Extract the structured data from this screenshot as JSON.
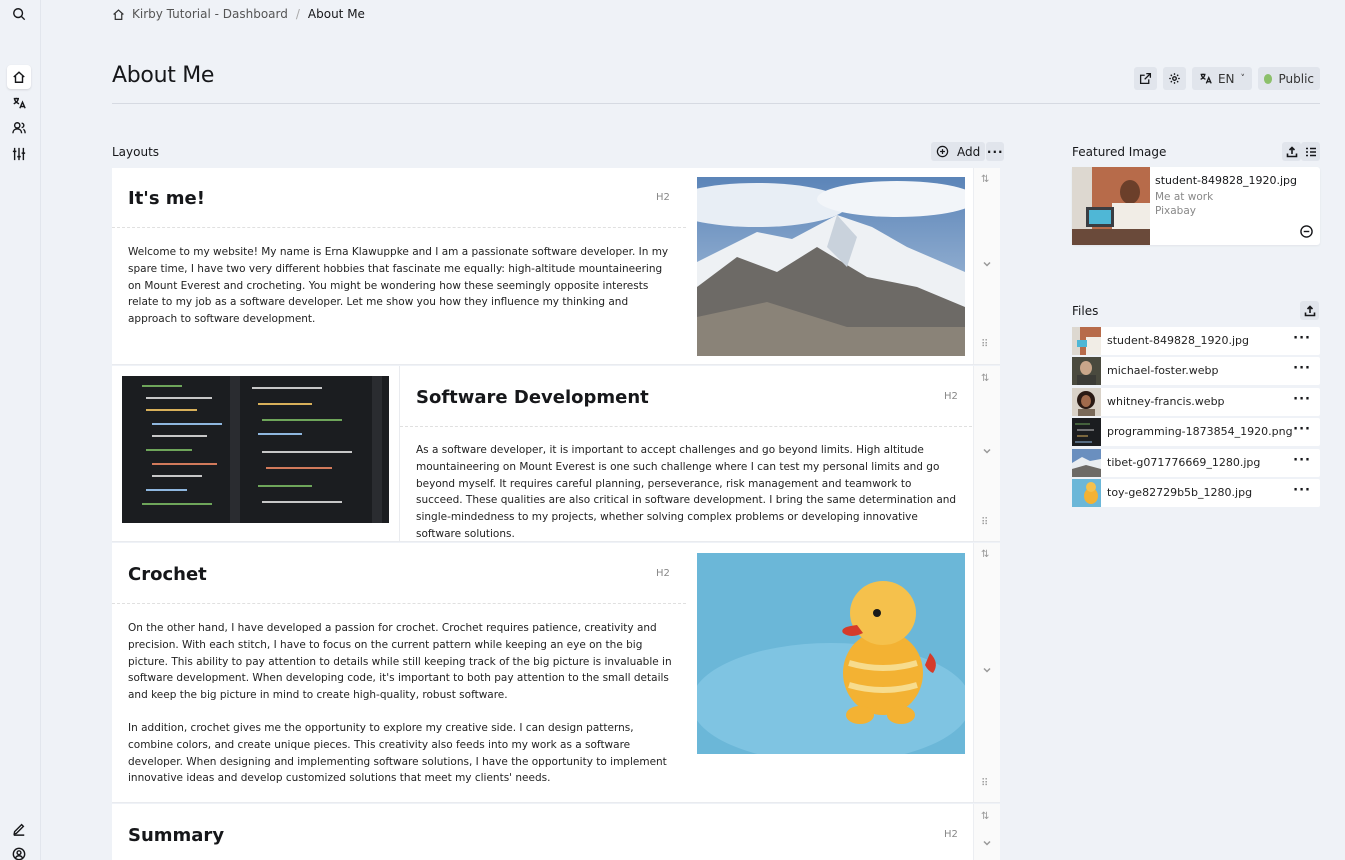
{
  "breadcrumb": {
    "home": "Kirby Tutorial - Dashboard",
    "current": "About Me"
  },
  "page": {
    "title": "About Me"
  },
  "top_actions": {
    "language": "EN",
    "status": "Public"
  },
  "layouts": {
    "label": "Layouts",
    "add_label": "Add",
    "blocks": [
      {
        "heading": "It's me!",
        "level": "H2",
        "text": "Welcome to my website! My name is Erna Klawuppke and I am a passionate software developer. In my spare time, I have two very different hobbies that fascinate me equally: high-altitude mountaineering on Mount Everest and crocheting. You might be wondering how these seemingly opposite interests relate to my job as a software developer. Let me show you how they influence my thinking and approach to software development."
      },
      {
        "heading": "Software Development",
        "level": "H2",
        "text": "As a software developer, it is important to accept challenges and go beyond limits. High altitude mountaineering on Mount Everest is one such challenge where I can test my personal limits and go beyond myself. It requires careful planning, perseverance, risk management and teamwork to succeed. These qualities are also critical in software development. I bring the same determination and single-mindedness to my projects, whether solving complex problems or developing innovative software solutions."
      },
      {
        "heading": "Crochet",
        "level": "H2",
        "text": "On the other hand, I have developed a passion for crochet. Crochet requires patience, creativity and precision. With each stitch, I have to focus on the current pattern while keeping an eye on the big picture. This ability to pay attention to details while still keeping track of the big picture is invaluable in software development. When developing code, it's important to both pay attention to the small details and keep the big picture in mind to create high-quality, robust software.",
        "text2": "In addition, crochet gives me the opportunity to explore my creative side. I can design patterns, combine colors, and create unique pieces. This creativity also feeds into my work as a software developer. When designing and implementing software solutions, I have the opportunity to implement innovative ideas and develop customized solutions that meet my clients' needs."
      },
      {
        "heading": "Summary",
        "level": "H2"
      }
    ]
  },
  "featured": {
    "label": "Featured Image",
    "filename": "student-849828_1920.jpg",
    "caption": "Me at work",
    "source": "Pixabay"
  },
  "files": {
    "label": "Files",
    "items": [
      "student-849828_1920.jpg",
      "michael-foster.webp",
      "whitney-francis.webp",
      "programming-1873854_1920.png",
      "tibet-g071776669_1280.jpg",
      "toy-ge82729b5b_1280.jpg"
    ]
  }
}
